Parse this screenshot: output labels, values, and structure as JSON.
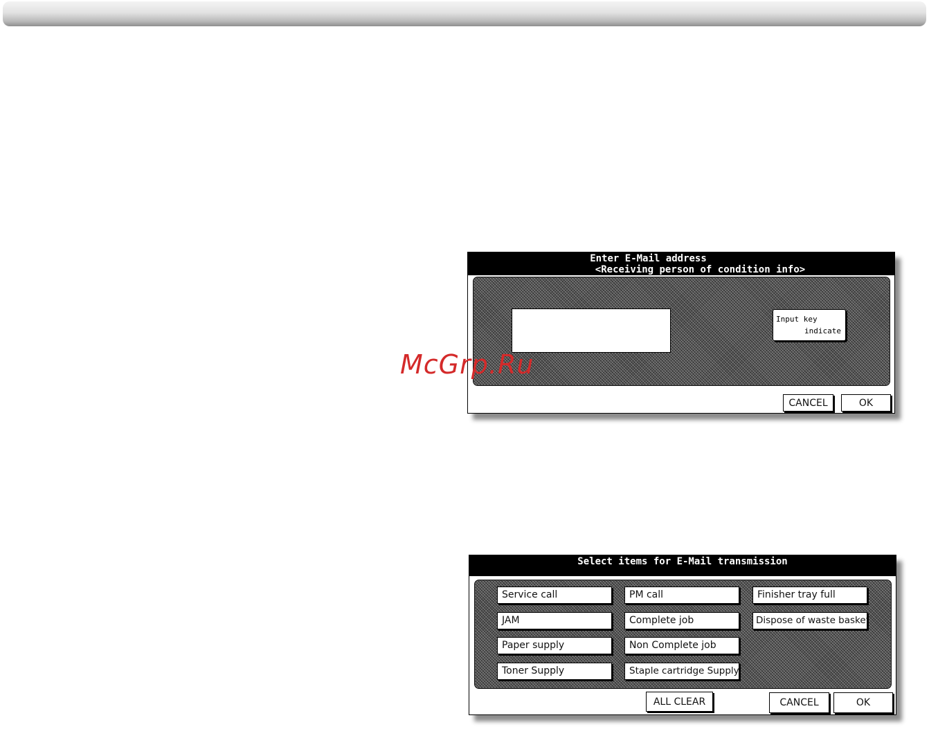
{
  "watermark": "McGrp.Ru",
  "email_dialog": {
    "title_line1": "Enter E-Mail address",
    "title_line2": "<Receiving person of condition info>",
    "address_value": "",
    "key_line1": "Input key",
    "key_line2": "indicate",
    "cancel_label": "CANCEL",
    "ok_label": "OK"
  },
  "select_dialog": {
    "title": "Select items for E-Mail transmission",
    "items": [
      "Service call",
      "JAM",
      "Paper supply",
      "Toner Supply",
      "PM call",
      "Complete job",
      "Non Complete job",
      "Staple cartridge Supply",
      "Finisher tray full",
      "Dispose of waste basket"
    ],
    "all_clear_label": "ALL CLEAR",
    "cancel_label": "CANCEL",
    "ok_label": "OK"
  }
}
